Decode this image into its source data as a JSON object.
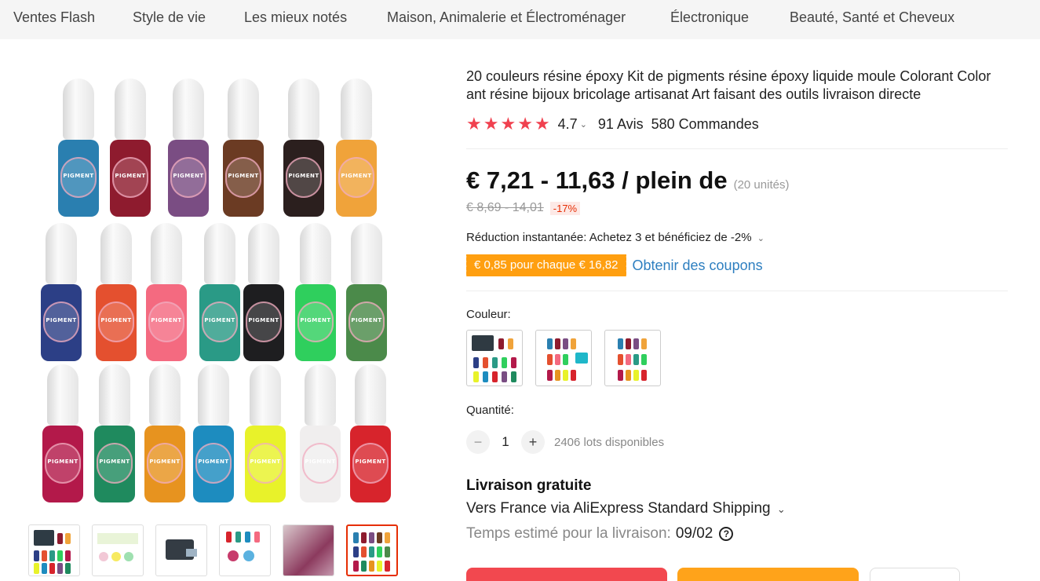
{
  "nav": {
    "items": [
      "Ventes Flash",
      "Style de vie",
      "Les mieux notés",
      "Maison, Animalerie et Électroménager",
      "Électronique",
      "Beauté, Santé et Cheveux"
    ]
  },
  "product": {
    "title": "20 couleurs résine époxy Kit de pigments résine époxy liquide moule Colorant Color ant résine bijoux bricolage artisanat Art faisant des outils livraison directe",
    "rating": "4.7",
    "rating_stars": 5,
    "reviews": "91 Avis",
    "orders": "580 Commandes",
    "price": "€ 7,21 - 11,63 / plein de",
    "units": "(20 unités)",
    "old_price": "€ 8,69 - 14,01",
    "discount": "-17%",
    "instant_discount": "Réduction instantanée: Achetez 3 et bénéficiez de -2%",
    "coupon": "€ 0,85 pour chaque € 16,82",
    "coupon_link": "Obtenir des coupons",
    "color_label": "Couleur:",
    "quantity_label": "Quantité:",
    "quantity": "1",
    "available": "2406 lots disponibles",
    "shipping_title": "Livraison gratuite",
    "shipping_via": "Vers France via AliExpress Standard Shipping",
    "delivery_label": "Temps estimé pour la livraison:",
    "delivery_date": "09/02"
  },
  "bottle_label": "PIGMENT",
  "bottle_colors": [
    "#2a7fb0",
    "#8e1b2e",
    "#7a4d83",
    "#6b3b23",
    "#2b1f1e",
    "#f0a33a",
    "#2c3f86",
    "#e4502f",
    "#f46a80",
    "#2a9a86",
    "#1e1e20",
    "#2fcf5d",
    "#4b8a4a",
    "#b3194a",
    "#1f8a5e",
    "#e7931f",
    "#1d8cbf",
    "#e8f22a",
    "#f0eeee",
    "#d7242c"
  ],
  "colors": {
    "accent": "#e62e04",
    "star": "#f0414f",
    "coupon": "#ff9f10",
    "link": "#2e7fc0"
  }
}
